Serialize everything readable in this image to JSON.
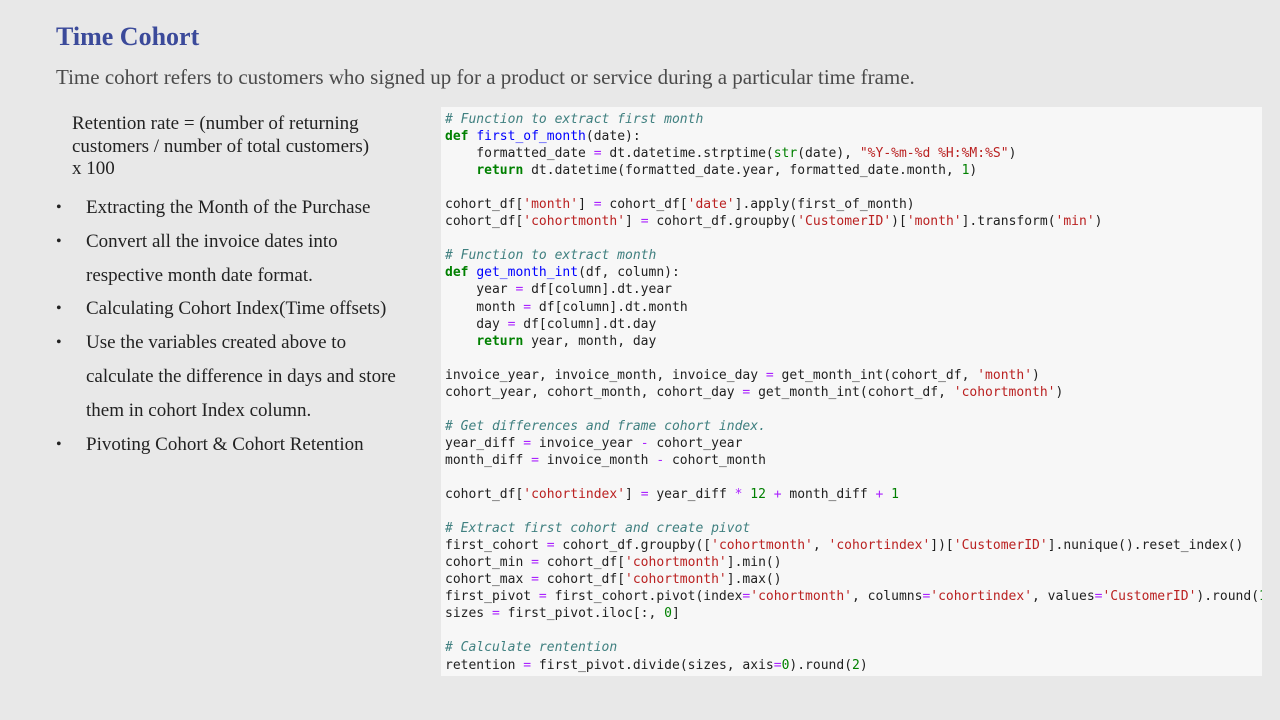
{
  "title": "Time Cohort",
  "subtitle": "Time cohort refers to customers who signed up for a product or service during a particular time frame.",
  "formula": "Retention rate = (number of returning customers / number of total customers) x 100",
  "bullets": [
    "Extracting the Month of the Purchase",
    "Convert all the invoice dates into respective month date format.",
    "Calculating Cohort Index(Time offsets)",
    "Use the variables created above to calculate the difference in days and store them in cohort Index column.",
    "Pivoting Cohort & Cohort Retention"
  ],
  "bullet_symbol": "•",
  "code_lines": [
    [
      [
        "c",
        "# Function to extract first month"
      ]
    ],
    [
      [
        "k",
        "def"
      ],
      [
        "p",
        " "
      ],
      [
        "f",
        "first_of_month"
      ],
      [
        "p",
        "(date):"
      ]
    ],
    [
      [
        "p",
        "    formatted_date "
      ],
      [
        "o",
        "="
      ],
      [
        "p",
        " dt.datetime.strptime("
      ],
      [
        "b",
        "str"
      ],
      [
        "p",
        "(date), "
      ],
      [
        "s",
        "\"%Y-%m-%d %H:%M:%S\""
      ],
      [
        "p",
        ")"
      ]
    ],
    [
      [
        "p",
        "    "
      ],
      [
        "k",
        "return"
      ],
      [
        "p",
        " dt.datetime(formatted_date.year, formatted_date.month, "
      ],
      [
        "n",
        "1"
      ],
      [
        "p",
        ")"
      ]
    ],
    [],
    [
      [
        "p",
        "cohort_df["
      ],
      [
        "s",
        "'month'"
      ],
      [
        "p",
        "] "
      ],
      [
        "o",
        "="
      ],
      [
        "p",
        " cohort_df["
      ],
      [
        "s",
        "'date'"
      ],
      [
        "p",
        "].apply(first_of_month)"
      ]
    ],
    [
      [
        "p",
        "cohort_df["
      ],
      [
        "s",
        "'cohortmonth'"
      ],
      [
        "p",
        "] "
      ],
      [
        "o",
        "="
      ],
      [
        "p",
        " cohort_df.groupby("
      ],
      [
        "s",
        "'CustomerID'"
      ],
      [
        "p",
        ")["
      ],
      [
        "s",
        "'month'"
      ],
      [
        "p",
        "].transform("
      ],
      [
        "s",
        "'min'"
      ],
      [
        "p",
        ")"
      ]
    ],
    [],
    [
      [
        "c",
        "# Function to extract month"
      ]
    ],
    [
      [
        "k",
        "def"
      ],
      [
        "p",
        " "
      ],
      [
        "f",
        "get_month_int"
      ],
      [
        "p",
        "(df, column):"
      ]
    ],
    [
      [
        "p",
        "    year "
      ],
      [
        "o",
        "="
      ],
      [
        "p",
        " df[column].dt.year"
      ]
    ],
    [
      [
        "p",
        "    month "
      ],
      [
        "o",
        "="
      ],
      [
        "p",
        " df[column].dt.month"
      ]
    ],
    [
      [
        "p",
        "    day "
      ],
      [
        "o",
        "="
      ],
      [
        "p",
        " df[column].dt.day"
      ]
    ],
    [
      [
        "p",
        "    "
      ],
      [
        "k",
        "return"
      ],
      [
        "p",
        " year, month, day"
      ]
    ],
    [],
    [
      [
        "p",
        "invoice_year, invoice_month, invoice_day "
      ],
      [
        "o",
        "="
      ],
      [
        "p",
        " get_month_int(cohort_df, "
      ],
      [
        "s",
        "'month'"
      ],
      [
        "p",
        ")"
      ]
    ],
    [
      [
        "p",
        "cohort_year, cohort_month, cohort_day "
      ],
      [
        "o",
        "="
      ],
      [
        "p",
        " get_month_int(cohort_df, "
      ],
      [
        "s",
        "'cohortmonth'"
      ],
      [
        "p",
        ")"
      ]
    ],
    [],
    [
      [
        "c",
        "# Get differences and frame cohort index."
      ]
    ],
    [
      [
        "p",
        "year_diff "
      ],
      [
        "o",
        "="
      ],
      [
        "p",
        " invoice_year "
      ],
      [
        "o",
        "-"
      ],
      [
        "p",
        " cohort_year"
      ]
    ],
    [
      [
        "p",
        "month_diff "
      ],
      [
        "o",
        "="
      ],
      [
        "p",
        " invoice_month "
      ],
      [
        "o",
        "-"
      ],
      [
        "p",
        " cohort_month"
      ]
    ],
    [],
    [
      [
        "p",
        "cohort_df["
      ],
      [
        "s",
        "'cohortindex'"
      ],
      [
        "p",
        "] "
      ],
      [
        "o",
        "="
      ],
      [
        "p",
        " year_diff "
      ],
      [
        "o",
        "*"
      ],
      [
        "p",
        " "
      ],
      [
        "n",
        "12"
      ],
      [
        "p",
        " "
      ],
      [
        "o",
        "+"
      ],
      [
        "p",
        " month_diff "
      ],
      [
        "o",
        "+"
      ],
      [
        "p",
        " "
      ],
      [
        "n",
        "1"
      ]
    ],
    [],
    [
      [
        "c",
        "# Extract first cohort and create pivot"
      ]
    ],
    [
      [
        "p",
        "first_cohort "
      ],
      [
        "o",
        "="
      ],
      [
        "p",
        " cohort_df.groupby(["
      ],
      [
        "s",
        "'cohortmonth'"
      ],
      [
        "p",
        ", "
      ],
      [
        "s",
        "'cohortindex'"
      ],
      [
        "p",
        "])["
      ],
      [
        "s",
        "'CustomerID'"
      ],
      [
        "p",
        "].nunique().reset_index()"
      ]
    ],
    [
      [
        "p",
        "cohort_min "
      ],
      [
        "o",
        "="
      ],
      [
        "p",
        " cohort_df["
      ],
      [
        "s",
        "'cohortmonth'"
      ],
      [
        "p",
        "].min()"
      ]
    ],
    [
      [
        "p",
        "cohort_max "
      ],
      [
        "o",
        "="
      ],
      [
        "p",
        " cohort_df["
      ],
      [
        "s",
        "'cohortmonth'"
      ],
      [
        "p",
        "].max()"
      ]
    ],
    [
      [
        "p",
        "first_pivot "
      ],
      [
        "o",
        "="
      ],
      [
        "p",
        " first_cohort.pivot(index"
      ],
      [
        "o",
        "="
      ],
      [
        "s",
        "'cohortmonth'"
      ],
      [
        "p",
        ", columns"
      ],
      [
        "o",
        "="
      ],
      [
        "s",
        "'cohortindex'"
      ],
      [
        "p",
        ", values"
      ],
      [
        "o",
        "="
      ],
      [
        "s",
        "'CustomerID'"
      ],
      [
        "p",
        ").round("
      ],
      [
        "n",
        "1"
      ],
      [
        "p",
        ")"
      ]
    ],
    [
      [
        "p",
        "sizes "
      ],
      [
        "o",
        "="
      ],
      [
        "p",
        " first_pivot.iloc[:, "
      ],
      [
        "n",
        "0"
      ],
      [
        "p",
        "]"
      ]
    ],
    [],
    [
      [
        "c",
        "# Calculate rentention"
      ]
    ],
    [
      [
        "p",
        "retention "
      ],
      [
        "o",
        "="
      ],
      [
        "p",
        " first_pivot.divide(sizes, axis"
      ],
      [
        "o",
        "="
      ],
      [
        "n",
        "0"
      ],
      [
        "p",
        ").round("
      ],
      [
        "n",
        "2"
      ],
      [
        "p",
        ")"
      ]
    ]
  ]
}
